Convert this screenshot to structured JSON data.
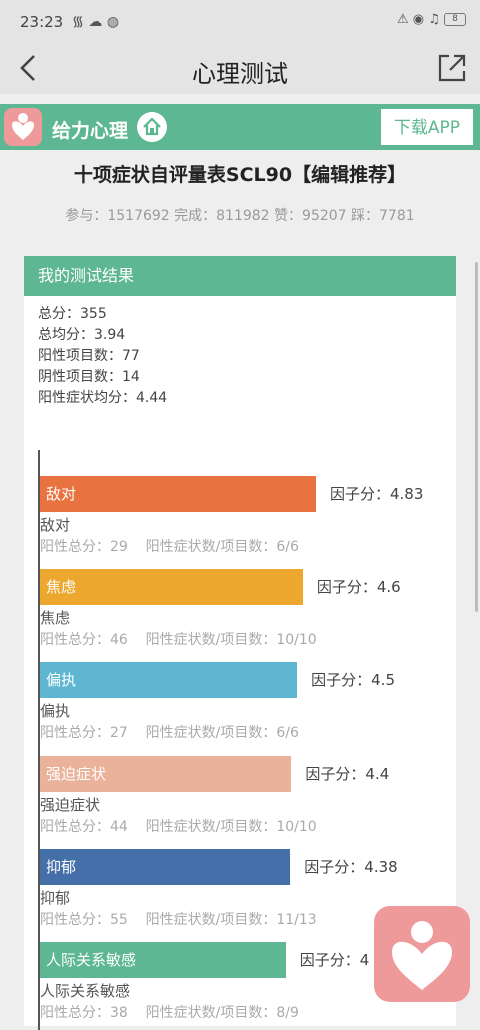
{
  "status": {
    "time": "23:23",
    "signal_text": "᯾ ☁ ◍",
    "right_icons": "⚠ ◉ ♫",
    "battery_level": "8"
  },
  "nav": {
    "title": "心理测试"
  },
  "brand": {
    "name": "给力心理",
    "download_label": "下载APP"
  },
  "test": {
    "title": "十项症状自评量表SCL90【编辑推荐】",
    "stats": "参与：1517692 完成：811982 赞：95207 踩：7781"
  },
  "result": {
    "header": "我的测试结果",
    "total": "总分：355",
    "average": "总均分：3.94",
    "positive_count": "阳性项目数：77",
    "negative_count": "阴性项目数：14",
    "positive_avg": "阳性症状均分：4.44"
  },
  "chart_data": {
    "type": "bar",
    "orientation": "horizontal",
    "categories": [
      "敌对",
      "焦虑",
      "偏执",
      "强迫症状",
      "抑郁",
      "人际关系敏感"
    ],
    "values": [
      4.83,
      4.6,
      4.5,
      4.4,
      4.38,
      4.3
    ],
    "colors": [
      "#e87340",
      "#eba72e",
      "#5fb6d1",
      "#eab29a",
      "#456fa8",
      "#5cb792"
    ]
  },
  "factors": [
    {
      "name": "敌对",
      "score_text": "因子分：4.83",
      "detail": "阳性总分：29    阳性症状数/项目数：6/6"
    },
    {
      "name": "焦虑",
      "score_text": "因子分：4.6",
      "detail": "阳性总分：46    阳性症状数/项目数：10/10"
    },
    {
      "name": "偏执",
      "score_text": "因子分：4.5",
      "detail": "阳性总分：27    阳性症状数/项目数：6/6"
    },
    {
      "name": "强迫症状",
      "score_text": "因子分：4.4",
      "detail": "阳性总分：44    阳性症状数/项目数：10/10"
    },
    {
      "name": "抑郁",
      "score_text": "因子分：4.38",
      "detail": "阳性总分：55    阳性症状数/项目数：11/13"
    },
    {
      "name": "人际关系敏感",
      "score_text": "因子分：4",
      "detail": "阳性总分：38    阳性症状数/项目数：8/9"
    }
  ]
}
